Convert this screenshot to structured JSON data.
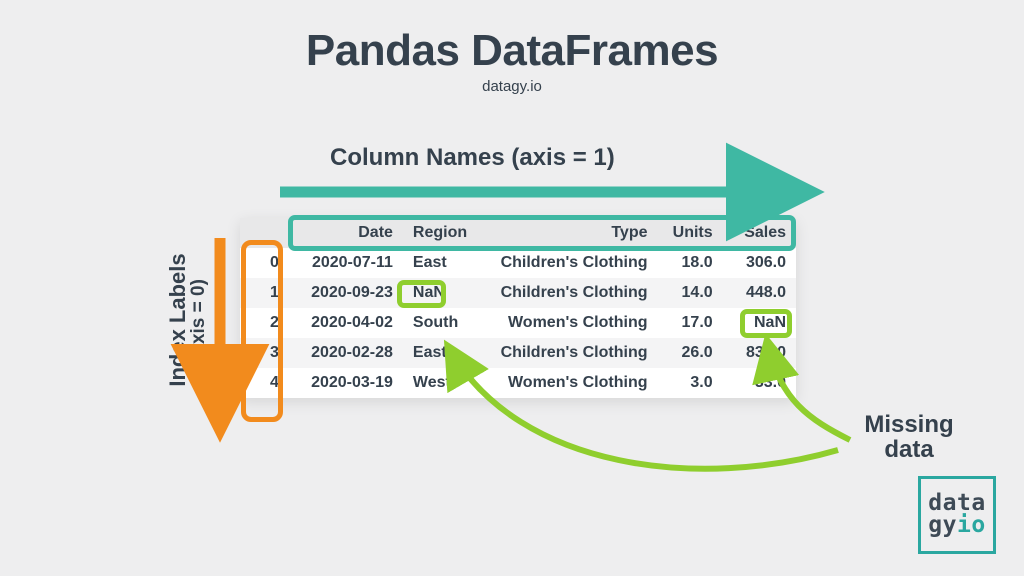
{
  "title": "Pandas DataFrames",
  "subtitle": "datagy.io",
  "axis_labels": {
    "columns": "Column Names (axis = 1)",
    "index_line1": "Index Labels",
    "index_line2": "(axis = 0)"
  },
  "missing_label_line1": "Missing",
  "missing_label_line2": "data",
  "table": {
    "columns": [
      "Date",
      "Region",
      "Type",
      "Units",
      "Sales"
    ],
    "index": [
      "0",
      "1",
      "2",
      "3",
      "4"
    ],
    "rows": [
      {
        "Date": "2020-07-11",
        "Region": "East",
        "Type": "Children's Clothing",
        "Units": "18.0",
        "Sales": "306.0"
      },
      {
        "Date": "2020-09-23",
        "Region": "NaN",
        "Type": "Children's Clothing",
        "Units": "14.0",
        "Sales": "448.0"
      },
      {
        "Date": "2020-04-02",
        "Region": "South",
        "Type": "Women's Clothing",
        "Units": "17.0",
        "Sales": "NaN"
      },
      {
        "Date": "2020-02-28",
        "Region": "East",
        "Type": "Children's Clothing",
        "Units": "26.0",
        "Sales": "832.0"
      },
      {
        "Date": "2020-03-19",
        "Region": "West",
        "Type": "Women's Clothing",
        "Units": "3.0",
        "Sales": "33.0"
      }
    ]
  },
  "annotations": {
    "highlight_header": true,
    "highlight_index": true,
    "nan_cells": [
      {
        "row": 1,
        "col": "Region"
      },
      {
        "row": 2,
        "col": "Sales"
      }
    ]
  },
  "colors": {
    "teal": "#3fb8a3",
    "orange": "#f28b1d",
    "lime": "#8fce2e",
    "text": "#35414d"
  },
  "logo": {
    "line1": "data",
    "line2a": "gy",
    "line2b": "io"
  }
}
